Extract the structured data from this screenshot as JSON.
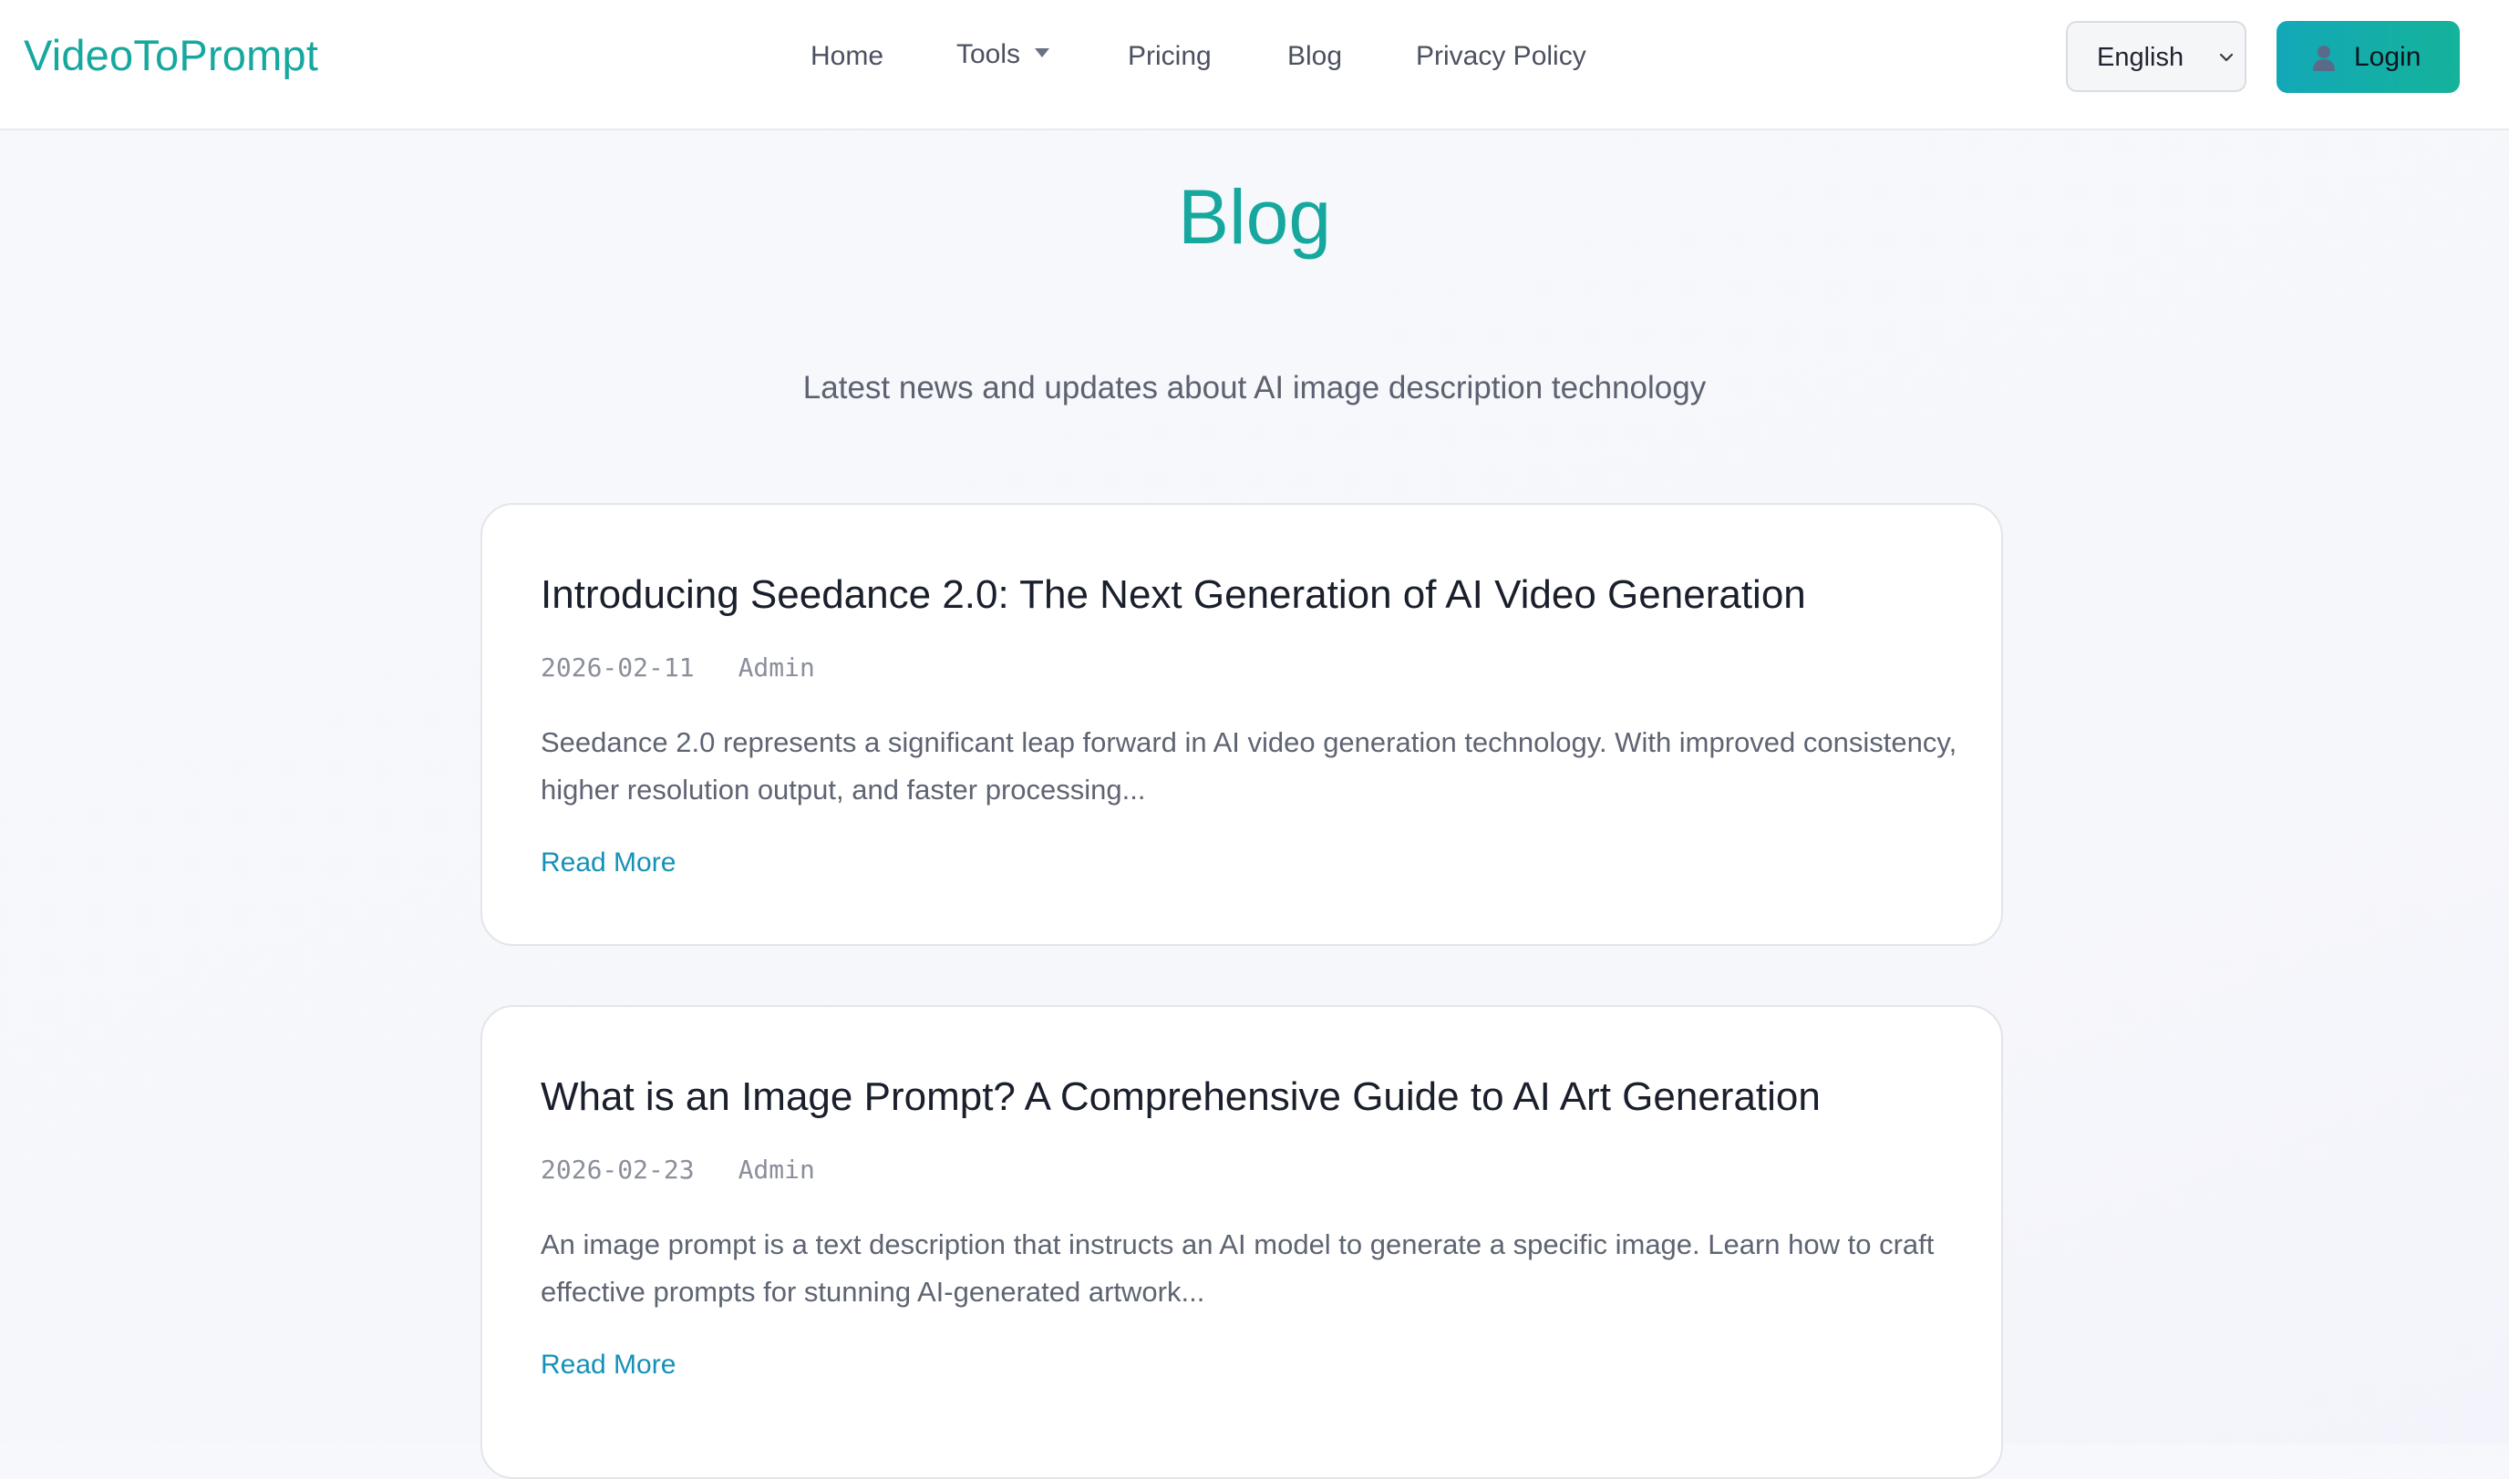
{
  "header": {
    "logo": "VideoToPrompt",
    "nav": {
      "home": "Home",
      "tools": "Tools",
      "pricing": "Pricing",
      "blog": "Blog",
      "privacy": "Privacy Policy"
    },
    "language": {
      "selected": "English"
    },
    "login_label": "Login"
  },
  "main": {
    "title": "Blog",
    "subtitle": "Latest news and updates about AI image description technology",
    "posts": [
      {
        "title": "Introducing Seedance 2.0: The Next Generation of AI Video Generation",
        "date": "2026-02-11",
        "author": "Admin",
        "excerpt": "Seedance 2.0 represents a significant leap forward in AI video generation technology. With improved consistency, higher resolution output, and faster processing...",
        "read_more": "Read More"
      },
      {
        "title": "What is an Image Prompt? A Comprehensive Guide to AI Art Generation",
        "date": "2026-02-23",
        "author": "Admin",
        "excerpt": "An image prompt is a text description that instructs an AI model to generate a specific image. Learn how to craft effective prompts for stunning AI-generated artwork...",
        "read_more": "Read More"
      }
    ]
  },
  "colors": {
    "brand": "#16a89f",
    "login_gradient_start": "#13a8b8",
    "login_gradient_end": "#14b39a",
    "link": "#1591b7",
    "page_background": "#f7f8fb"
  },
  "icons": {
    "tools_dropdown": "caret-down-icon",
    "language_dropdown": "chevron-down-icon",
    "login": "user-icon"
  }
}
